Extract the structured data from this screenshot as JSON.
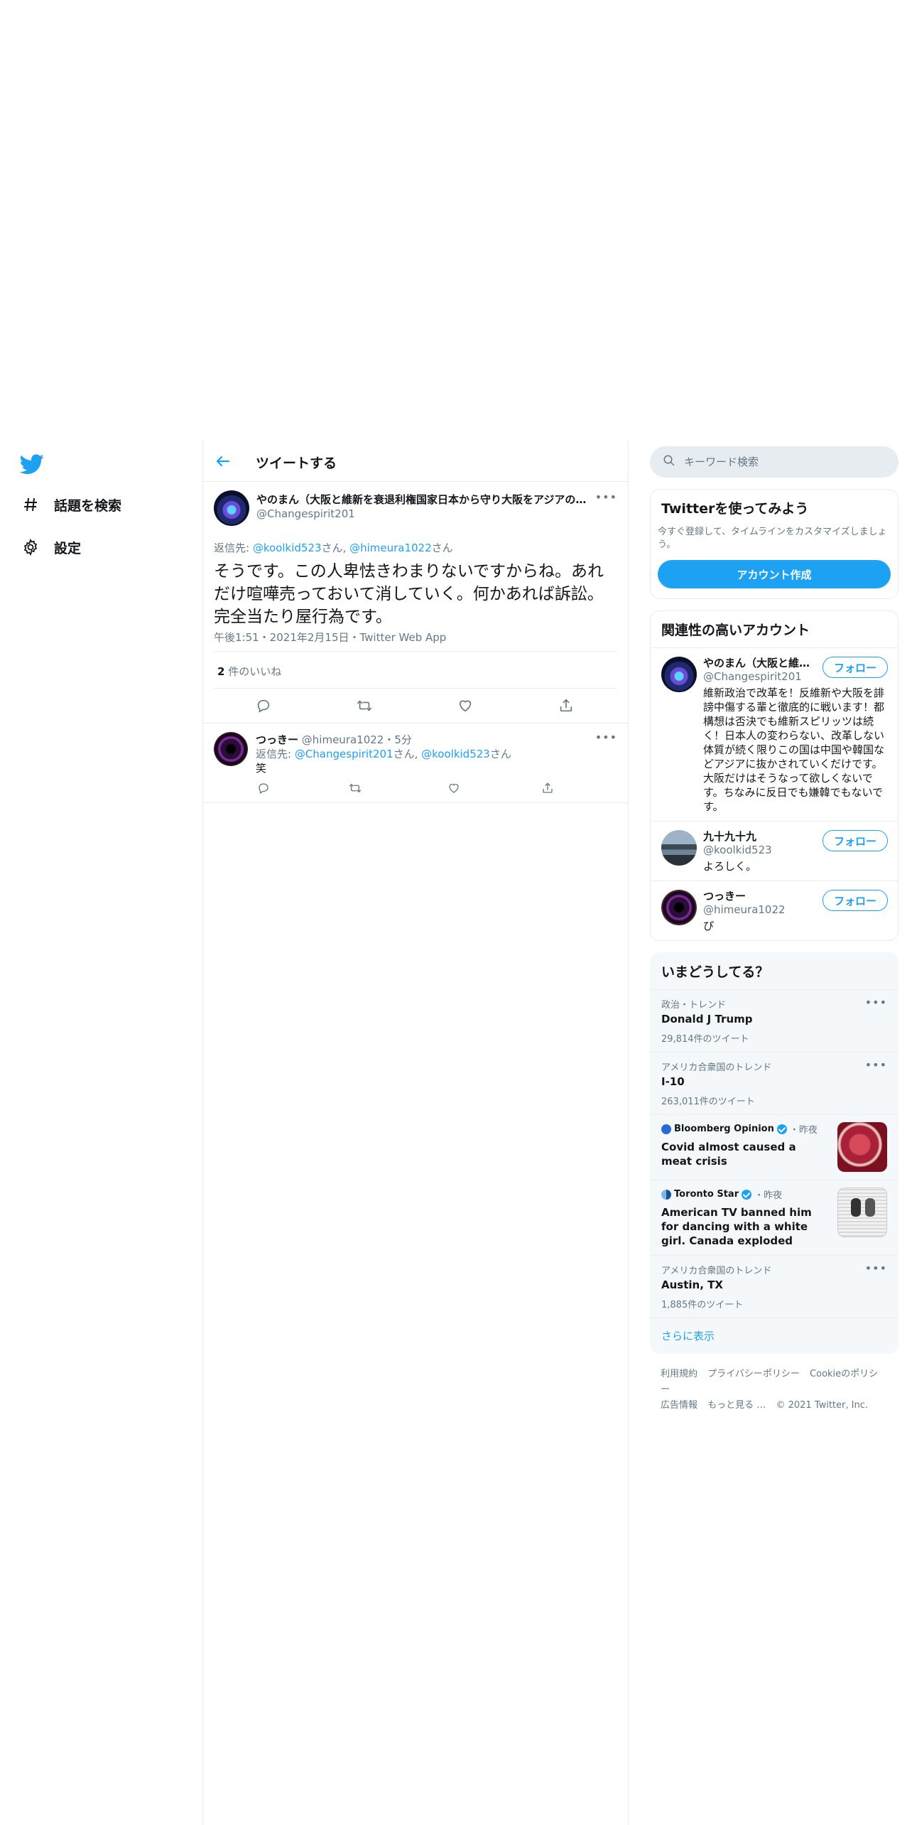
{
  "nav": {
    "items": [
      {
        "label": "話題を検索"
      },
      {
        "label": "設定"
      }
    ]
  },
  "header": {
    "title": "ツイートする"
  },
  "main_tweet": {
    "name": "やのまん（大阪と維新を衰退利権国家日本から守り大阪をアジアの…",
    "handle": "@Changespirit201",
    "reply_prefix": "返信先: ",
    "reply_to_1": "@koolkid523",
    "reply_san_1": "さん, ",
    "reply_to_2": "@himeura1022",
    "reply_san_2": "さん",
    "text": "そうです。この人卑怯きわまりないですからね。あれだけ喧嘩売っておいて消していく。何かあれば訴訟。完全当たり屋行為です。",
    "meta": "午後1:51・2021年2月15日・Twitter Web App",
    "likes_count": "2",
    "likes_label": " 件のいいね"
  },
  "reply": {
    "name": "つっきー",
    "handle": "@himeura1022",
    "time": "・5分",
    "reply_prefix": "返信先: ",
    "reply_to_1": "@Changespirit201",
    "reply_san_1": "さん, ",
    "reply_to_2": "@koolkid523",
    "reply_san_2": "さん",
    "text": "笑"
  },
  "search": {
    "placeholder": "キーワード検索"
  },
  "signup": {
    "title": "Twitterを使ってみよう",
    "desc": "今すぐ登録して、タイムラインをカスタマイズしましょう。",
    "button": "アカウント作成"
  },
  "related": {
    "title": "関連性の高いアカウント",
    "follow_label": "フォロー",
    "accounts": [
      {
        "name": "やのまん（大阪と維…",
        "handle": "@Changespirit201",
        "bio": "維新政治で改革を！反維新や大阪を誹謗中傷する輩と徹底的に戦います！都構想は否決でも維新スピリッツは続く！日本人の変わらない、改革しない体質が続く限りこの国は中国や韓国などアジアに抜かされていくだけです。大阪だけはそうなって欲しくないです。ちなみに反日でも嫌韓でもないです。"
      },
      {
        "name": "九十九十九",
        "handle": "@koolkid523",
        "bio": "よろしく。"
      },
      {
        "name": "つっきー",
        "handle": "@himeura1022",
        "bio": "ぴ"
      }
    ]
  },
  "trends": {
    "title": "いまどうしてる？",
    "items": [
      {
        "context": "政治・トレンド",
        "topic": "Donald J Trump",
        "count": "29,814件のツイート"
      },
      {
        "context": "アメリカ合衆国のトレンド",
        "topic": "I-10",
        "count": "263,011件のツイート"
      }
    ],
    "news": [
      {
        "source": "Bloomberg Opinion",
        "time": "・昨夜",
        "headline": "Covid almost caused a meat crisis"
      },
      {
        "source": "Toronto Star",
        "time": "・昨夜",
        "headline": "American TV banned him for dancing with a white girl. Canada exploded"
      }
    ],
    "items2": [
      {
        "context": "アメリカ合衆国のトレンド",
        "topic": "Austin, TX",
        "count": "1,885件のツイート"
      }
    ],
    "show_more": "さらに表示"
  },
  "footer": {
    "links": [
      "利用規約",
      "プライバシーポリシー",
      "Cookieのポリシー",
      "広告情報",
      "もっと見る …"
    ],
    "copyright": "© 2021 Twitter, Inc."
  },
  "colors": {
    "accent": "#1da1f2",
    "text": "#14171a",
    "muted": "#657786",
    "border": "#e6ecf0"
  }
}
